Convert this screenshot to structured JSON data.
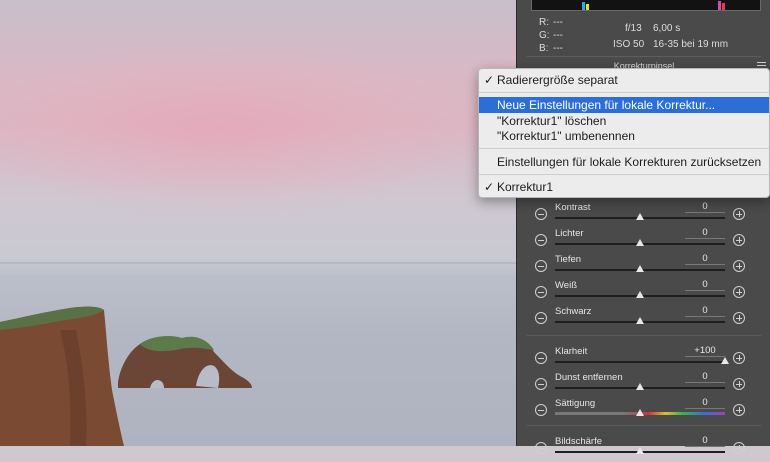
{
  "histogram": {
    "readout": {
      "r_label": "R:",
      "g_label": "G:",
      "b_label": "B:",
      "r": "---",
      "g": "---",
      "b": "---"
    },
    "camera": {
      "aperture": "f/13",
      "shutter": "6,00 s",
      "iso": "ISO 50",
      "lens": "16-35 bei 19 mm"
    }
  },
  "panel": {
    "title": "Korrekturpinsel"
  },
  "context_menu": {
    "items": [
      {
        "label": "Radierergröße separat",
        "checked": true,
        "selected": false
      },
      {
        "label": "Neue Einstellungen für lokale Korrektur...",
        "checked": false,
        "selected": true
      },
      {
        "label": "\"Korrektur1\" löschen",
        "checked": false,
        "selected": false
      },
      {
        "label": "\"Korrektur1\" umbenennen",
        "checked": false,
        "selected": false
      },
      {
        "label": "Einstellungen für lokale Korrekturen zurücksetzen",
        "checked": false,
        "selected": false
      },
      {
        "label": "Korrektur1",
        "checked": true,
        "selected": false
      }
    ],
    "check_glyph": "✓"
  },
  "sliders": [
    {
      "label": "Kontrast",
      "value": "0",
      "level": 0.5
    },
    {
      "label": "Lichter",
      "value": "0",
      "level": 0.5
    },
    {
      "label": "Tiefen",
      "value": "0",
      "level": 0.5
    },
    {
      "label": "Weiß",
      "value": "0",
      "level": 0.5
    },
    {
      "label": "Schwarz",
      "value": "0",
      "level": 0.5
    },
    {
      "label": "Klarheit",
      "value": "+100",
      "level": 1.0
    },
    {
      "label": "Dunst entfernen",
      "value": "0",
      "level": 0.5
    },
    {
      "label": "Sättigung",
      "value": "0",
      "level": 0.5
    },
    {
      "label": "Bildschärfe",
      "value": "0",
      "level": 0.5
    }
  ],
  "colors": {
    "selection": "#2b6ed6",
    "panel_bg": "#4a4a4a"
  }
}
